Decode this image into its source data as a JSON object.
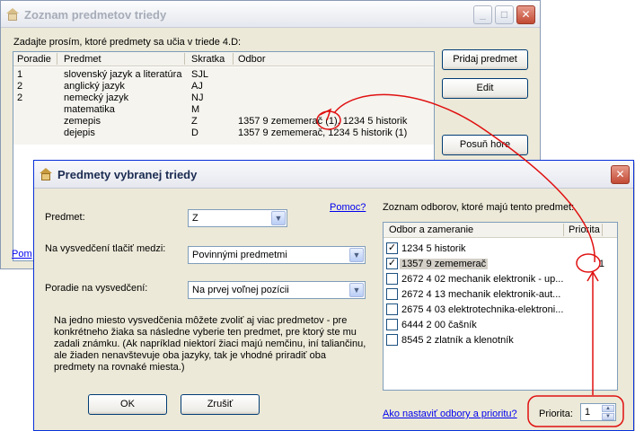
{
  "back_window": {
    "title": "Zoznam predmetov triedy",
    "buttons": [
      "_",
      "□",
      "✕"
    ],
    "instruction": "Zadajte prosím, ktoré predmety sa učia v triede 4.D:",
    "columns": [
      "Poradie",
      "Predmet",
      "Skratka",
      "Odbor"
    ],
    "rows": [
      {
        "poradie": "1",
        "predmet": "slovenský jazyk a literatúra",
        "skratka": "SJL",
        "odbor": ""
      },
      {
        "poradie": "2",
        "predmet": "anglický jazyk",
        "skratka": "AJ",
        "odbor": ""
      },
      {
        "poradie": "2",
        "predmet": "nemecký jazyk",
        "skratka": "NJ",
        "odbor": ""
      },
      {
        "poradie": "",
        "predmet": "matematika",
        "skratka": "M",
        "odbor": ""
      },
      {
        "poradie": "",
        "predmet": "zemepis",
        "skratka": "Z",
        "odbor": "1357 9 zememerač (1), 1234 5 historik"
      },
      {
        "poradie": "",
        "predmet": "dejepis",
        "skratka": "D",
        "odbor": "1357 9 zememerač, 1234 5 historik (1)"
      }
    ],
    "add_button": "Pridaj predmet",
    "edit_button": "Edit",
    "move_up_button": "Posuň hore",
    "link_partial": "Pom"
  },
  "dialog": {
    "title": "Predmety vybranej triedy",
    "close": "✕",
    "predmet_label": "Predmet:",
    "predmet_value": "Z",
    "help_link": "Pomoc?",
    "print_label": "Na vysvedčení tlačiť medzi:",
    "print_value": "Povinnými predmetmi",
    "order_label": "Poradie na vysvedčení:",
    "order_value": "Na prvej voľnej pozícii",
    "note": "Na jedno miesto vysvedčenia môžete zvoliť aj viac predmetov - pre konkrétneho žiaka sa následne vyberie ten predmet, pre ktorý ste mu zadali známku. (Ak napríklad niektorí žiaci majú nemčinu, iní taliančinu, ale žiaden nenavštevuje oba jazyky, tak je vhodné priradiť oba predmety na rovnaké miesta.)",
    "ok_button": "OK",
    "cancel_button": "Zrušiť",
    "odbory_label": "Zoznam odborov, ktoré majú tento predmet:",
    "odbory_columns": [
      "Odbor a zameranie",
      "Priorita"
    ],
    "odbory": [
      {
        "name": "1234 5 historik",
        "checked": true,
        "priorita": "",
        "selected": false
      },
      {
        "name": "1357 9 zememerač",
        "checked": true,
        "priorita": "1",
        "selected": true
      },
      {
        "name": "2672 4 02 mechanik elektronik - up...",
        "checked": false,
        "priorita": "",
        "selected": false
      },
      {
        "name": "2672 4 13 mechanik elektronik-aut...",
        "checked": false,
        "priorita": "",
        "selected": false
      },
      {
        "name": "2675 4 03 elektrotechnika-elektroni...",
        "checked": false,
        "priorita": "",
        "selected": false
      },
      {
        "name": "6444 2 00 čašník",
        "checked": false,
        "priorita": "",
        "selected": false
      },
      {
        "name": "8545 2 zlatník a klenotník",
        "checked": false,
        "priorita": "",
        "selected": false
      }
    ],
    "setup_link": "Ako nastaviť odbory a prioritu?",
    "priority_label": "Priorita:",
    "priority_value": "1"
  },
  "icons": {
    "window": "app-house-icon",
    "dropdown": "chevron-down-icon",
    "spin_up": "arrow-up-icon",
    "spin_down": "arrow-down-icon"
  },
  "colors": {
    "annotation": "#e01010",
    "link": "#0000ee",
    "selection": "#d4d0c8",
    "dialog_border": "#0831d9"
  }
}
